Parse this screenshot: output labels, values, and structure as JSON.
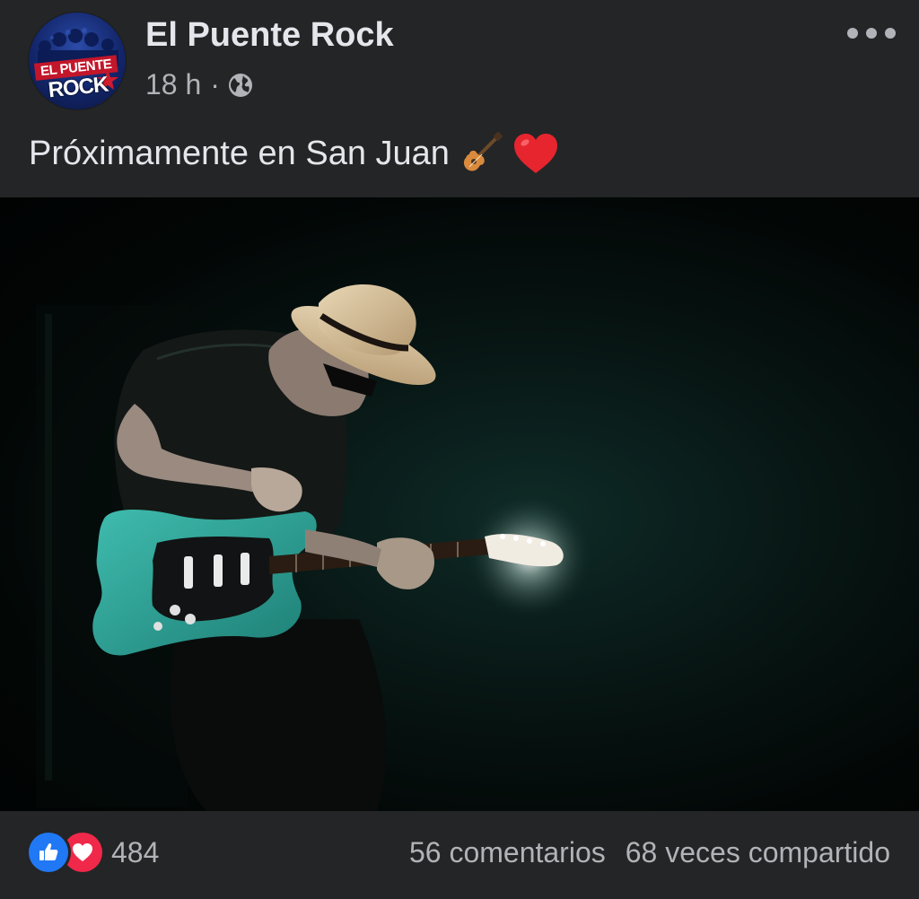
{
  "post": {
    "page_name": "El Puente Rock",
    "avatar_text": [
      "EL PUENTE",
      "ROCK"
    ],
    "time": "18 h",
    "separator": "·",
    "privacy_icon": "globe-icon",
    "text": "Próximamente en San Juan",
    "emojis": [
      "guitar-emoji",
      "red-heart-emoji"
    ]
  },
  "photo": {
    "subject": "guitarist-with-hat"
  },
  "footer": {
    "reaction_icons": [
      "like-icon",
      "love-icon"
    ],
    "reaction_count": "484",
    "comments": "56 comentarios",
    "shares": "68 veces compartido"
  },
  "colors": {
    "background": "#242526",
    "primary_text": "#e4e6eb",
    "secondary_text": "#b0b3b8",
    "like_blue": "#2078f4",
    "love_red": "#f0284a",
    "guitar_teal": "#2aa59a"
  }
}
